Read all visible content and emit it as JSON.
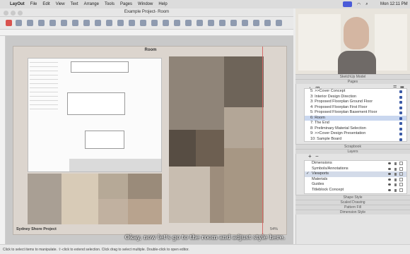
{
  "menubar": {
    "app_name": "LayOut",
    "menus": [
      "File",
      "Edit",
      "View",
      "Text",
      "Arrange",
      "Tools",
      "Pages",
      "Window",
      "Help"
    ],
    "clock": "Mon 12:11 PM"
  },
  "window": {
    "title": "Example Project- Room"
  },
  "document": {
    "page_title": "Room",
    "project_name": "Sydney Shore",
    "project_label": "Project",
    "page_number": "54%"
  },
  "panels": {
    "model_header": "SketchUp Model",
    "pages_header": "Pages",
    "pages": [
      "5: >>Cover Concept",
      "3: Interior Design Direction",
      "3: Proposed Floorplan Ground Floor",
      "4: Proposed Floorplan First Floor",
      "5: Proposed Floorplan Basement Floor",
      "6: Room",
      "7: The End",
      "8: Preliminary Material Selection",
      "9: >>Cover Design Presentation",
      "10: Sample Board"
    ],
    "selected_page_index": 5,
    "scrapbook_header": "Scrapbook",
    "layers_header": "Layers",
    "layers": [
      "Dimensions",
      "Symbols/Annotations",
      "Viewports",
      "Materials",
      "Guides",
      "Titleblock Concept"
    ],
    "selected_layer_index": 2,
    "collapsed_headers": [
      "Shape Style",
      "Scaled Drawing",
      "Pattern Fill",
      "Dimension Style"
    ]
  },
  "statusbar": {
    "text": "Click to select items to manipulate. ⇧-click to extend selection. Click drag to select multiple. Double-click to open editor."
  },
  "caption": "Okay, now let's go to the room and adjust style here.",
  "colors": {
    "accent": "#3b5aa6",
    "page_background": "#dcd5ce",
    "canvas": "#c9c9c9"
  }
}
